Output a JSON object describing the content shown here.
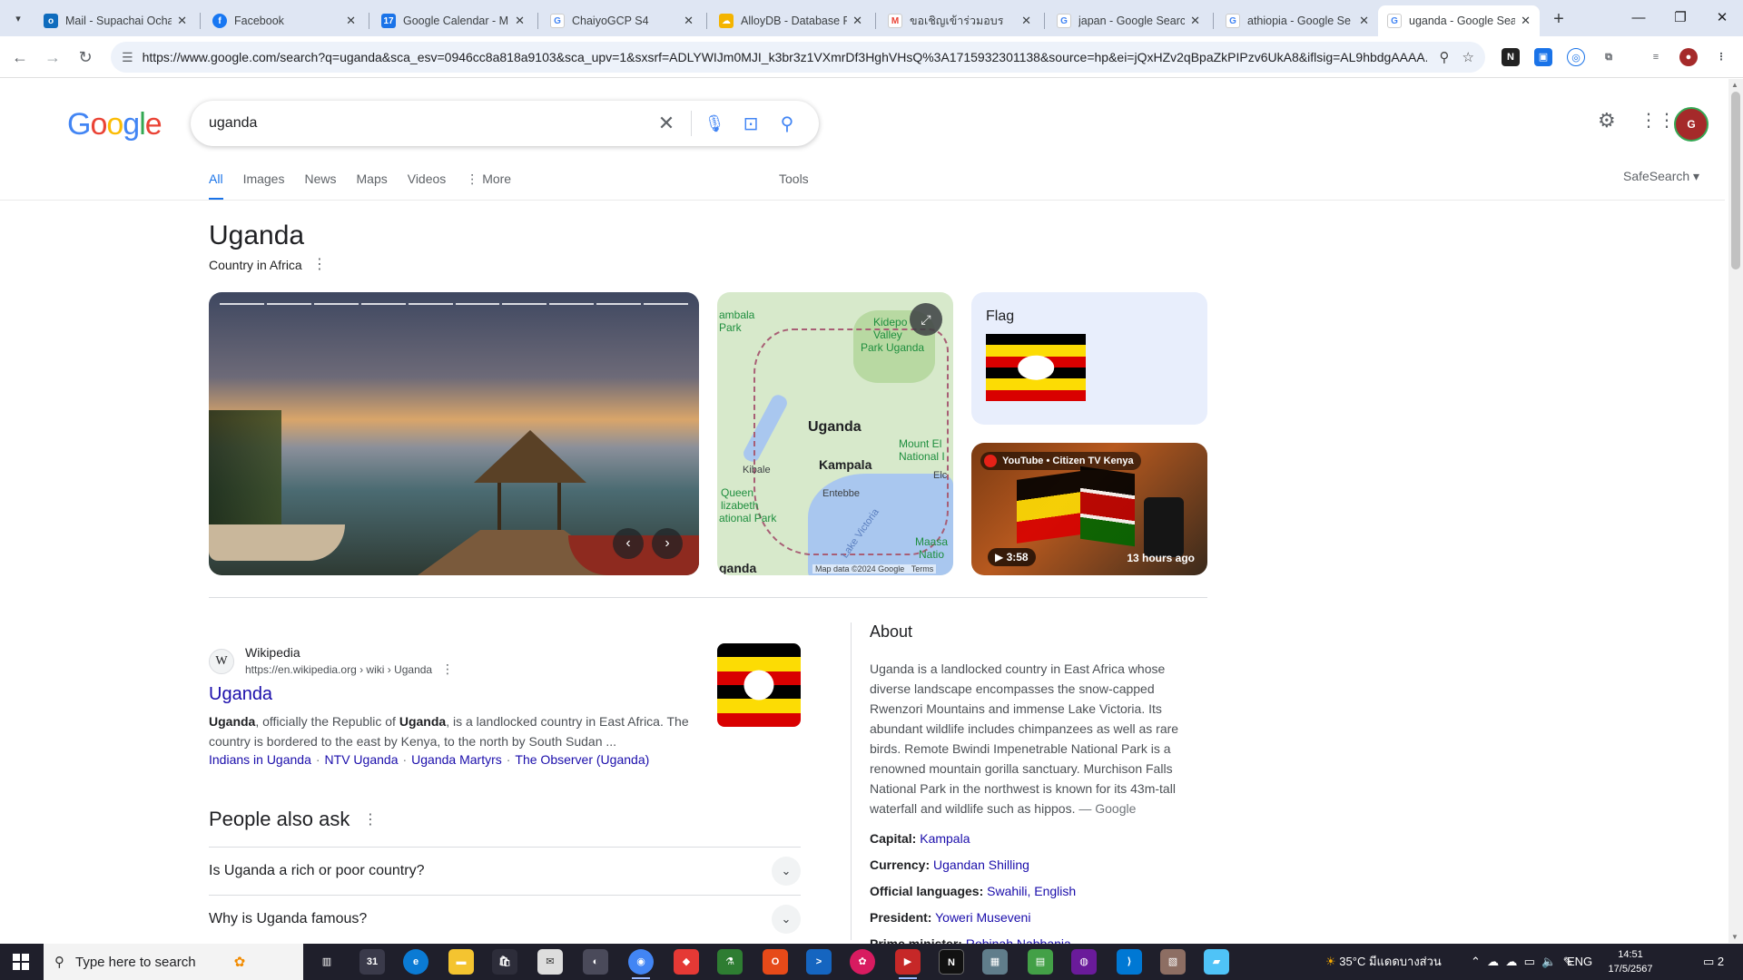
{
  "browser": {
    "tabs": [
      {
        "title": "Mail - Supachai Ocha",
        "favicon": "outlook-icon",
        "color": "#0f6cbd"
      },
      {
        "title": "Facebook",
        "favicon": "facebook-icon",
        "color": "#1877f2"
      },
      {
        "title": "Google Calendar - M",
        "favicon": "calendar-icon",
        "color": "#1a73e8"
      },
      {
        "title": "ChaiyoGCP S4",
        "favicon": "google-icon",
        "color": "#4285f4"
      },
      {
        "title": "AlloyDB - Database F",
        "favicon": "cloud-icon",
        "color": "#f4b400"
      },
      {
        "title": "ขอเชิญเข้าร่วมอบร",
        "favicon": "gmail-icon",
        "color": "#ea4335"
      },
      {
        "title": "japan - Google Searc",
        "favicon": "google-icon",
        "color": "#4285f4"
      },
      {
        "title": "athiopia - Google Se",
        "favicon": "google-icon",
        "color": "#4285f4"
      },
      {
        "title": "uganda - Google Sea",
        "favicon": "google-icon",
        "color": "#4285f4"
      }
    ],
    "url": "https://www.google.com/search?q=uganda&sca_esv=0946cc8a818a9103&sca_upv=1&sxsrf=ADLYWIJm0MJI_k3br3z1VXmrDf3HghVHsQ%3A1715932301138&source=hp&ei=jQxHZv2qBpaZkPIPzv6UkA8&iflsig=AL9hbdgAAAA..."
  },
  "google": {
    "logo": [
      "G",
      "o",
      "o",
      "g",
      "l",
      "e"
    ],
    "logo_colors": [
      "#4285f4",
      "#ea4335",
      "#fbbc05",
      "#4285f4",
      "#34a853",
      "#ea4335"
    ],
    "query": "uganda",
    "tabs": [
      "All",
      "Images",
      "News",
      "Maps",
      "Videos",
      "More"
    ],
    "tools": "Tools",
    "safesearch": "SafeSearch"
  },
  "knowledge": {
    "title": "Uganda",
    "subtitle": "Country in Africa",
    "map": {
      "labels": {
        "ambala": "ambala",
        "park": "Park",
        "kidepo": "Kidepo",
        "valley": "Valley",
        "park_uganda": "Park Uganda",
        "uganda": "Uganda",
        "kampala": "Kampala",
        "kibale": "Kibale",
        "entebbe": "Entebbe",
        "queen": "Queen",
        "elizabeth": "lizabeth",
        "national_park": "ational Park",
        "mount": "Mount El",
        "national": "National I",
        "elc": "Elc",
        "lake": "Lake Victoria",
        "maasai": "Maasa",
        "nati": "Natio",
        "ganda": "ganda"
      },
      "footer": "Map data ©2024 Google",
      "terms": "Terms"
    },
    "flag_label": "Flag",
    "video": {
      "source": "YouTube • Citizen TV Kenya",
      "duration": "3:58",
      "ago": "13 hours ago"
    }
  },
  "result": {
    "site": "Wikipedia",
    "favicon_letter": "W",
    "url": "https://en.wikipedia.org › wiki › Uganda",
    "title": "Uganda",
    "snippet": [
      "Uganda",
      ", officially the Republic of ",
      "Uganda",
      ", is a landlocked country in East Africa. The country is bordered to the east by Kenya, to the north by South Sudan ..."
    ],
    "links": [
      "Indians in Uganda",
      "NTV Uganda",
      "Uganda Martyrs",
      "The Observer (Uganda)"
    ]
  },
  "people_also_ask": {
    "title": "People also ask",
    "questions": [
      "Is Uganda a rich or poor country?",
      "Why is Uganda famous?"
    ]
  },
  "about": {
    "title": "About",
    "text": "Uganda is a landlocked country in East Africa whose diverse landscape encompasses the snow-capped Rwenzori Mountains and immense Lake Victoria. Its abundant wildlife includes chimpanzees as well as rare birds. Remote Bwindi Impenetrable National Park is a renowned mountain gorilla sanctuary. Murchison Falls National Park in the northwest is known for its 43m-tall waterfall and wildlife such as hippos.",
    "source": "— Google",
    "facts": [
      {
        "label": "Capital:",
        "value": "Kampala"
      },
      {
        "label": "Currency:",
        "value": "Ugandan Shilling"
      },
      {
        "label": "Official languages:",
        "value": "Swahili, English"
      },
      {
        "label": "President:",
        "value": "Yoweri Museveni"
      },
      {
        "label": "Prime minister:",
        "value": "Robinah Nabbanja"
      }
    ]
  },
  "taskbar": {
    "search_placeholder": "Type here to search",
    "weather": "35°C",
    "weather_desc": "มีแดดบางส่วน",
    "lang": "ENG",
    "time": "14:51",
    "date": "17/5/2567",
    "notifications": "2"
  }
}
